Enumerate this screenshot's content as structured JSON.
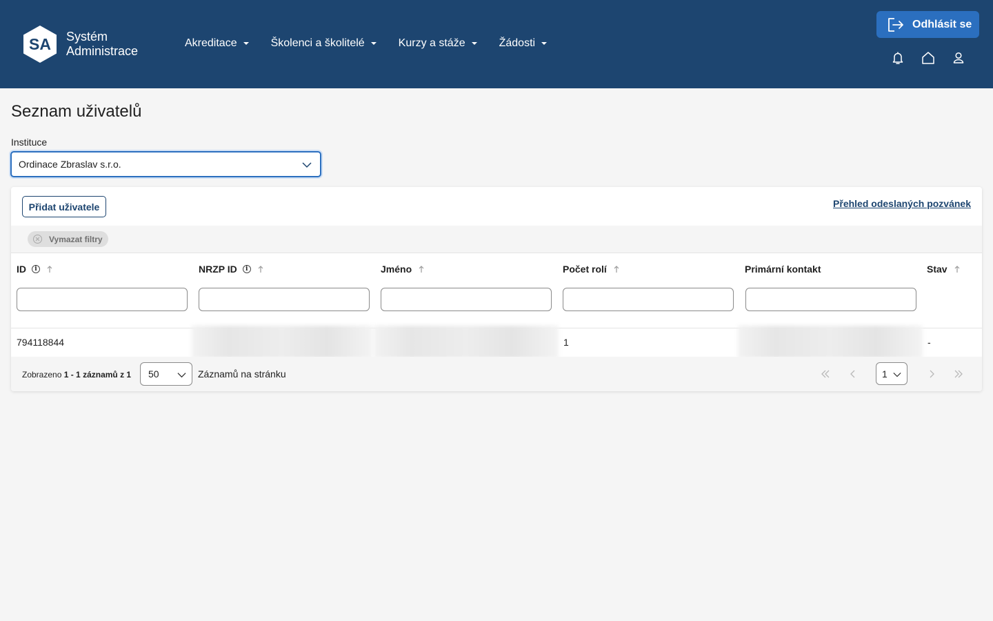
{
  "app": {
    "logo_initials": "SA",
    "name_line1": "Systém",
    "name_line2": "Administrace"
  },
  "nav": [
    {
      "label": "Akreditace"
    },
    {
      "label": "Školenci a školitelé"
    },
    {
      "label": "Kurzy a stáže"
    },
    {
      "label": "Žádosti"
    }
  ],
  "header": {
    "logout_label": "Odhlásit se",
    "icons": [
      "bell-icon",
      "home-icon",
      "user-icon"
    ]
  },
  "page": {
    "title": "Seznam uživatelů",
    "institution_label": "Instituce",
    "institution_value": "Ordinace Zbraslav s.r.o."
  },
  "toolbar": {
    "add_users_label": "Přidat uživatele",
    "invitations_link": "Přehled odeslaných pozvánek",
    "clear_filters_label": "Vymazat filtry"
  },
  "table": {
    "columns": [
      {
        "label": "ID",
        "info": true,
        "sortable": true,
        "filter": true
      },
      {
        "label": "NRZP ID",
        "info": true,
        "sortable": true,
        "filter": true
      },
      {
        "label": "Jméno",
        "info": false,
        "sortable": true,
        "filter": true
      },
      {
        "label": "Počet rolí",
        "info": false,
        "sortable": true,
        "filter": true
      },
      {
        "label": "Primární kontakt",
        "info": false,
        "sortable": false,
        "filter": true
      },
      {
        "label": "Stav",
        "info": false,
        "sortable": true,
        "filter": false
      }
    ],
    "rows": [
      {
        "id": "794118844",
        "nrzp_id": "",
        "name": "",
        "roles": "1",
        "contact": "",
        "status": "-"
      }
    ]
  },
  "pagination": {
    "shown_prefix": "Zobrazeno",
    "shown_range": "1 - 1 záznamů z 1",
    "per_page_value": "50",
    "per_page_label": "Záznamů na stránku",
    "current_page": "1"
  },
  "colors": {
    "header_bg": "#1d4570",
    "accent": "#2b6fbf"
  }
}
